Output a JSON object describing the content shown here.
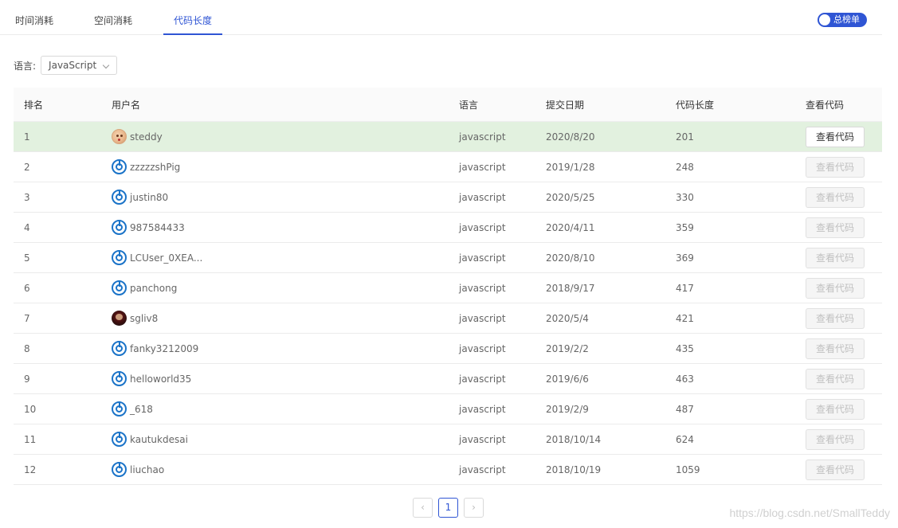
{
  "tabs": [
    {
      "label": "时间消耗",
      "active": false
    },
    {
      "label": "空间消耗",
      "active": false
    },
    {
      "label": "代码长度",
      "active": true
    }
  ],
  "toggle": {
    "label": "总榜单",
    "on": true
  },
  "language_filter": {
    "label": "语言:",
    "selected": "JavaScript"
  },
  "table": {
    "headers": [
      "排名",
      "用户名",
      "语言",
      "提交日期",
      "代码长度",
      "查看代码"
    ],
    "rows": [
      {
        "rank": "1",
        "user": "steddy",
        "avatar": "cookie-avatar",
        "lang": "javascript",
        "date": "2020/8/20",
        "len": "201",
        "btn": "查看代码",
        "enabled": true
      },
      {
        "rank": "2",
        "user": "zzzzzshPig",
        "avatar": "default-avatar",
        "lang": "javascript",
        "date": "2019/1/28",
        "len": "248",
        "btn": "查看代码",
        "enabled": false
      },
      {
        "rank": "3",
        "user": "justin80",
        "avatar": "default-avatar",
        "lang": "javascript",
        "date": "2020/5/25",
        "len": "330",
        "btn": "查看代码",
        "enabled": false
      },
      {
        "rank": "4",
        "user": "987584433",
        "avatar": "default-avatar",
        "lang": "javascript",
        "date": "2020/4/11",
        "len": "359",
        "btn": "查看代码",
        "enabled": false
      },
      {
        "rank": "5",
        "user": "LCUser_0XEA...",
        "avatar": "default-avatar",
        "lang": "javascript",
        "date": "2020/8/10",
        "len": "369",
        "btn": "查看代码",
        "enabled": false
      },
      {
        "rank": "6",
        "user": "panchong",
        "avatar": "default-avatar",
        "lang": "javascript",
        "date": "2018/9/17",
        "len": "417",
        "btn": "查看代码",
        "enabled": false
      },
      {
        "rank": "7",
        "user": "sgliv8",
        "avatar": "photo-avatar",
        "lang": "javascript",
        "date": "2020/5/4",
        "len": "421",
        "btn": "查看代码",
        "enabled": false
      },
      {
        "rank": "8",
        "user": "fanky3212009",
        "avatar": "default-avatar",
        "lang": "javascript",
        "date": "2019/2/2",
        "len": "435",
        "btn": "查看代码",
        "enabled": false
      },
      {
        "rank": "9",
        "user": "helloworld35",
        "avatar": "default-avatar",
        "lang": "javascript",
        "date": "2019/6/6",
        "len": "463",
        "btn": "查看代码",
        "enabled": false
      },
      {
        "rank": "10",
        "user": "_618",
        "avatar": "default-avatar",
        "lang": "javascript",
        "date": "2019/2/9",
        "len": "487",
        "btn": "查看代码",
        "enabled": false
      },
      {
        "rank": "11",
        "user": "kautukdesai",
        "avatar": "default-avatar",
        "lang": "javascript",
        "date": "2018/10/14",
        "len": "624",
        "btn": "查看代码",
        "enabled": false
      },
      {
        "rank": "12",
        "user": "liuchao",
        "avatar": "default-avatar",
        "lang": "javascript",
        "date": "2018/10/19",
        "len": "1059",
        "btn": "查看代码",
        "enabled": false
      }
    ]
  },
  "pagination": {
    "prev": "‹",
    "page": "1",
    "next": "›"
  },
  "watermark": "https://blog.csdn.net/SmallTeddy",
  "colors": {
    "accent": "#2f55d4",
    "highlight_row": "#e2f1df"
  }
}
